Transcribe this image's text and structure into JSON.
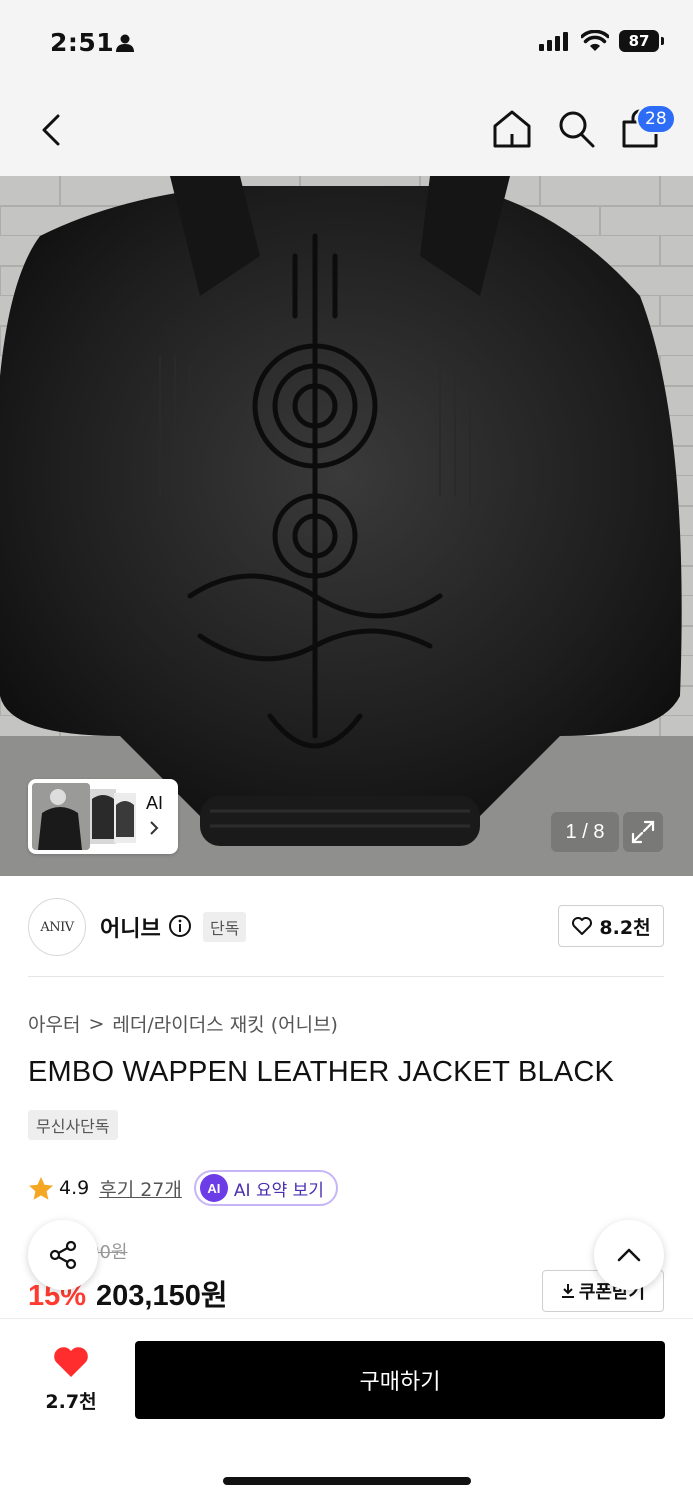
{
  "status_bar": {
    "time": "2:51",
    "battery": "87"
  },
  "nav": {
    "cart_count": "28"
  },
  "gallery": {
    "ai_label": "AI",
    "counter": "1 / 8"
  },
  "brand": {
    "logo_text": "ANIV",
    "name": "어니브",
    "badge": "단독",
    "likes": "8.2천"
  },
  "breadcrumb": {
    "category": "아우터",
    "separator": ">",
    "subcategory": "레더/라이더스 재킷 (어니브)"
  },
  "product": {
    "title": "EMBO WAPPEN LEATHER JACKET BLACK",
    "tag": "무신사단독",
    "rating": "4.9",
    "review_link": "후기 27개",
    "ai_chip": "AI",
    "ai_summary": "AI 요약 보기",
    "original_price": "00원",
    "discount": "15%",
    "price": "203,150원",
    "coupon_label": "쿠폰받기"
  },
  "bottom": {
    "wish_count": "2.7천",
    "buy_label": "구매하기"
  },
  "colors": {
    "accent_blue": "#2d6cf6",
    "sale_red": "#ff3b30",
    "ai_purple": "#6c3ce6",
    "star": "#f5a623"
  }
}
